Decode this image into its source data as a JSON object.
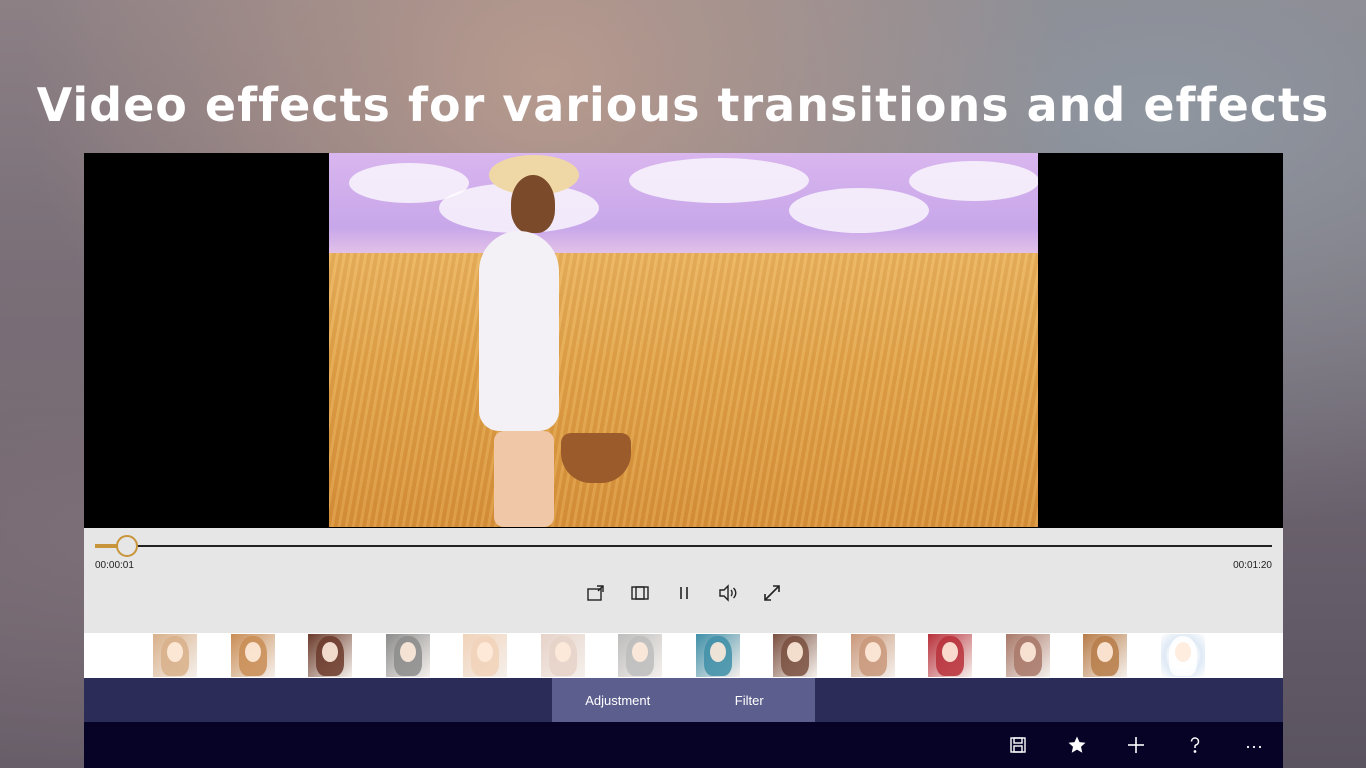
{
  "headline": "Video effects for various transitions and effects",
  "player": {
    "current_time": "00:00:01",
    "total_time": "00:01:20",
    "progress": 0.026
  },
  "controls": [
    {
      "name": "rotate-button",
      "icon": "rotate-icon"
    },
    {
      "name": "crop-button",
      "icon": "crop-icon"
    },
    {
      "name": "pause-button",
      "icon": "pause-icon"
    },
    {
      "name": "volume-button",
      "icon": "volume-icon"
    },
    {
      "name": "fullscreen-button",
      "icon": "expand-icon"
    }
  ],
  "effects": [
    {
      "name": "original",
      "tone": "#d8b08a"
    },
    {
      "name": "warm",
      "tone": "#c98d55"
    },
    {
      "name": "dark",
      "tone": "#6b3a2a"
    },
    {
      "name": "grayscale",
      "tone": "#8c8c8c"
    },
    {
      "name": "bright",
      "tone": "#f1d2b8"
    },
    {
      "name": "faded",
      "tone": "#e6d2c8"
    },
    {
      "name": "sketch",
      "tone": "#bdbdbd"
    },
    {
      "name": "cyan",
      "tone": "#3f8fa8"
    },
    {
      "name": "mosaic",
      "tone": "#7a5040"
    },
    {
      "name": "soft",
      "tone": "#c9987a"
    },
    {
      "name": "vivid",
      "tone": "#b8303a"
    },
    {
      "name": "grid",
      "tone": "#a87868"
    },
    {
      "name": "sepia",
      "tone": "#b77c48"
    },
    {
      "name": "splash",
      "tone": "#ffffff"
    }
  ],
  "tabs": {
    "adjustment": "Adjustment",
    "filter": "Filter"
  },
  "command_bar": [
    {
      "name": "save-button",
      "icon": "save-icon"
    },
    {
      "name": "favorite-button",
      "icon": "star-icon"
    },
    {
      "name": "add-button",
      "icon": "plus-icon"
    },
    {
      "name": "help-button",
      "icon": "help-icon"
    },
    {
      "name": "more-button",
      "icon": "more-icon"
    }
  ],
  "colors": {
    "accent": "#c9953a",
    "tab_bar": "#2b2d58",
    "tab_active_group": "#5c5e8e",
    "command_bar": "#060327"
  }
}
